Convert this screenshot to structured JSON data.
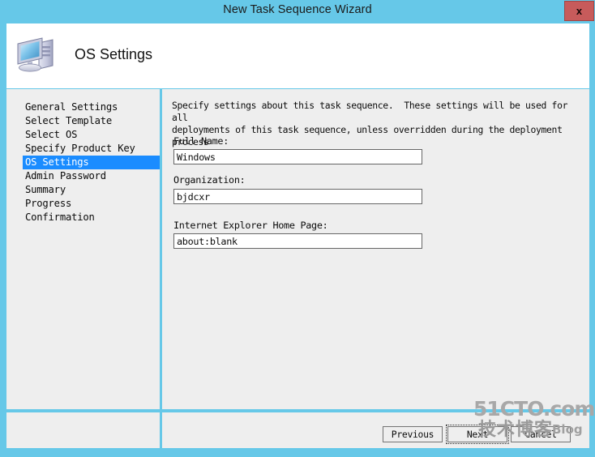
{
  "window": {
    "title": "New Task Sequence Wizard",
    "close_label": "x",
    "titlebar_color": "#66c8e8",
    "panel_color": "#eeeeee",
    "accent_color": "#1a8cff"
  },
  "header": {
    "title": "OS Settings",
    "icon": "computer-icon"
  },
  "sidebar": {
    "items": [
      {
        "label": "General Settings",
        "selected": false
      },
      {
        "label": "Select Template",
        "selected": false
      },
      {
        "label": "Select OS",
        "selected": false
      },
      {
        "label": "Specify Product Key",
        "selected": false
      },
      {
        "label": "OS Settings",
        "selected": true
      },
      {
        "label": "Admin Password",
        "selected": false
      },
      {
        "label": "Summary",
        "selected": false
      },
      {
        "label": "Progress",
        "selected": false
      },
      {
        "label": "Confirmation",
        "selected": false
      }
    ]
  },
  "content": {
    "description": "Specify settings about this task sequence.  These settings will be used for all\ndeployments of this task sequence, unless overridden during the deployment process",
    "fields": [
      {
        "label": "Full Name:",
        "value": "Windows",
        "placeholder": ""
      },
      {
        "label": "Organization:",
        "value": "bjdcxr",
        "placeholder": ""
      },
      {
        "label": "Internet Explorer Home Page:",
        "value": "about:blank",
        "placeholder": ""
      }
    ]
  },
  "footer": {
    "previous_label": "Previous",
    "next_label": "Next",
    "cancel_label": "Cancel"
  },
  "watermark": {
    "top": "51CTO.com",
    "cn": "技术博客",
    "blog": "Blog"
  }
}
